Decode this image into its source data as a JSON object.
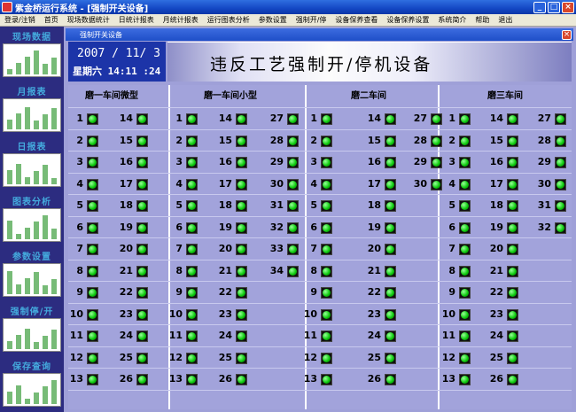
{
  "window": {
    "title": "紫金桥运行系统 - [强制开关设备]",
    "min": "_",
    "max": "□",
    "close": "×"
  },
  "menu": [
    "登录/注销",
    "首页",
    "现场数据统计",
    "日统计报表",
    "月统计报表",
    "运行图表分析",
    "参数设置",
    "强制开/停",
    "设备保养查看",
    "设备保养设置",
    "系统简介",
    "帮助",
    "退出"
  ],
  "sidebar": [
    {
      "label": "现场数据"
    },
    {
      "label": "月报表"
    },
    {
      "label": "日报表"
    },
    {
      "label": "图表分析"
    },
    {
      "label": "参数设置"
    },
    {
      "label": "强制停/开"
    },
    {
      "label": "保存查询"
    }
  ],
  "panel": {
    "title": "强制开关设备",
    "close": "×"
  },
  "datetime": {
    "date": "2007 / 11/  3",
    "time": "星期六 14:11 :24"
  },
  "banner": {
    "title": "违反工艺强制开/停机设备"
  },
  "sections": [
    {
      "title": "磨一车间微型",
      "columns": [
        [
          1,
          2,
          3,
          4,
          5,
          6,
          7,
          8,
          9,
          10,
          11,
          12,
          13
        ],
        [
          14,
          15,
          16,
          17,
          18,
          19,
          20,
          21,
          22,
          23,
          24,
          25,
          26
        ]
      ]
    },
    {
      "title": "磨一车间小型",
      "columns": [
        [
          1,
          2,
          3,
          4,
          5,
          6,
          7,
          8,
          9,
          10,
          11,
          12,
          13
        ],
        [
          14,
          15,
          16,
          17,
          18,
          19,
          20,
          21,
          22,
          23,
          24,
          25,
          26
        ],
        [
          27,
          28,
          29,
          30,
          31,
          32,
          33,
          34
        ]
      ]
    },
    {
      "title": "磨二车间",
      "columns": [
        [
          1,
          2,
          3,
          4,
          5,
          6,
          7,
          8,
          9,
          10,
          11,
          12,
          13
        ],
        [
          14,
          15,
          16,
          17,
          18,
          19,
          20,
          21,
          22,
          23,
          24,
          25,
          26
        ],
        [
          27,
          28,
          29,
          30
        ]
      ]
    },
    {
      "title": "磨三车间",
      "columns": [
        [
          1,
          2,
          3,
          4,
          5,
          6,
          7,
          8,
          9,
          10,
          11,
          12,
          13
        ],
        [
          14,
          15,
          16,
          17,
          18,
          19,
          20,
          21,
          22,
          23,
          24,
          25,
          26
        ],
        [
          27,
          28,
          29,
          30,
          31,
          32
        ]
      ]
    }
  ],
  "colors": {
    "led_on": "#22cc22",
    "panel_bg": "#a2a3db",
    "title_blue": "#1447c4"
  }
}
